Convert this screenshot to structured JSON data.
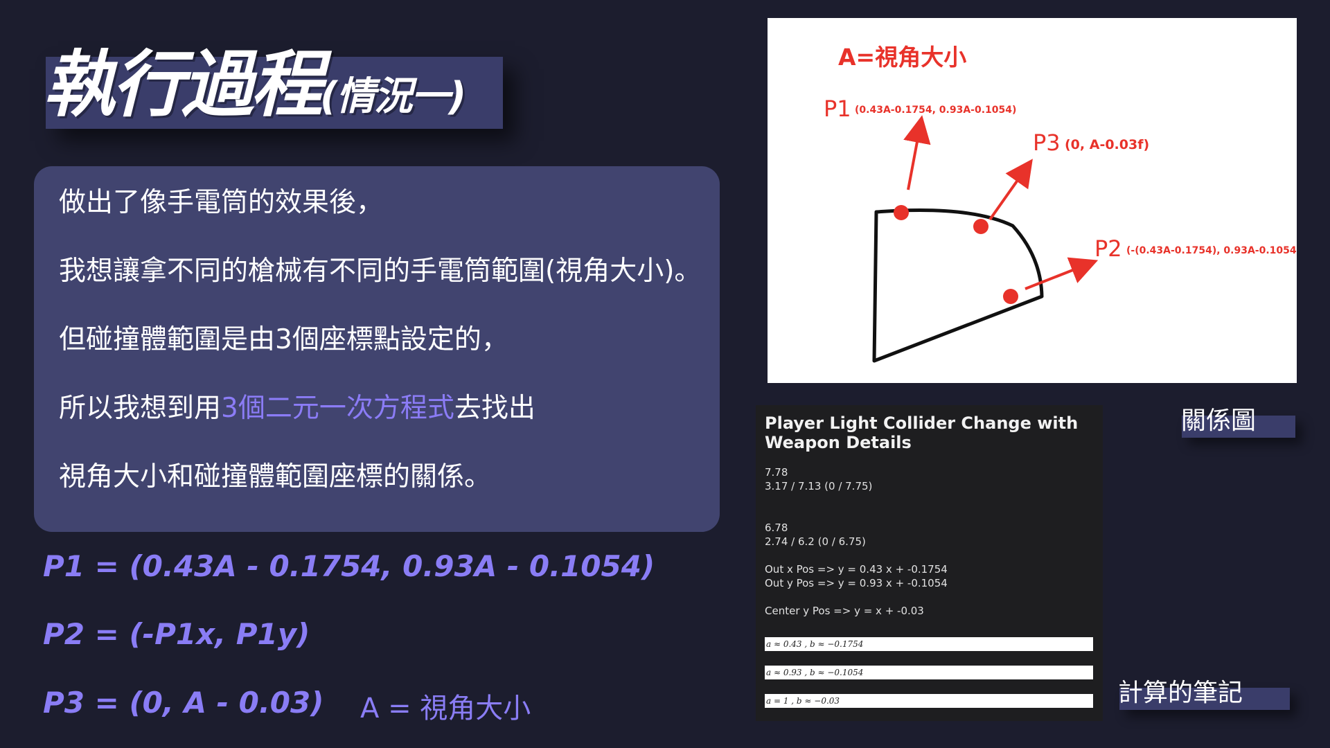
{
  "title": {
    "main": "執行過程",
    "sub": "(情況一)"
  },
  "panel": {
    "line1": "做出了像手電筒的效果後，",
    "line2": "我想讓拿不同的槍械有不同的手電筒範圍(視角大小)。",
    "line3": "但碰撞體範圍是由3個座標點設定的，",
    "line4_pre": "所以我想到用",
    "line4_highlight": "3個二元一次方程式",
    "line4_post": "去找出",
    "line5": "視角大小和碰撞體範圍座標的關係。"
  },
  "formulas": {
    "p1": "P1 = (0.43A - 0.1754, 0.93A - 0.1054)",
    "p2": "P2 = (-P1x, P1y)",
    "p3": "P3 = (0, A - 0.03)",
    "a_def": "A  =  視角大小"
  },
  "diagram": {
    "a_label": "A=視角大小",
    "p1_label": "P1",
    "p1_coords": "(0.43A-0.1754, 0.93A-0.1054)",
    "p3_label": "P3",
    "p3_coords": "(0,  A-0.03f)",
    "p2_label": "P2",
    "p2_coords": "(-(0.43A-0.1754), 0.93A-0.1054)",
    "caption": "關係圖",
    "accent": "#e8322a"
  },
  "notes": {
    "title": "Player Light Collider Change with Weapon Details",
    "l1": "7.78",
    "l2": "3.17 / 7.13 (0 / 7.75)",
    "l3": "6.78",
    "l4": "2.74 / 6.2 (0 / 6.75)",
    "l5": "Out x Pos =>  y = 0.43 x + -0.1754",
    "l6": "Out y Pos =>  y = 0.93 x + -0.1054",
    "l7": "Center y Pos => y = x + -0.03",
    "r1": "a ≈ 0.43 ,   b ≈ −0.1754",
    "r2": "a ≈ 0.93 ,   b ≈ −0.1054",
    "r3": "a = 1 ,   b ≈ −0.03",
    "caption": "計算的筆記"
  }
}
